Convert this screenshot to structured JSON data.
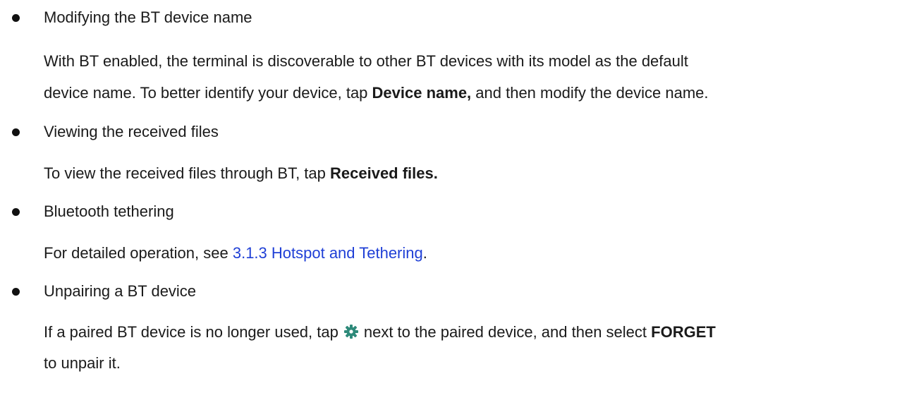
{
  "sections": [
    {
      "title": "Modifying the BT device name",
      "body_line1": "With BT enabled, the terminal is discoverable to other BT devices with its model as the default",
      "body_line2_pre": "device name. To better identify your device, tap ",
      "body_line2_bold": "Device name,",
      "body_line2_post": " and then modify the device name."
    },
    {
      "title": "Viewing the received files",
      "body_pre": "To view the received files through BT, tap ",
      "body_bold": "Received files."
    },
    {
      "title": "Bluetooth tethering",
      "body_pre": "For detailed operation, see ",
      "body_link": "3.1.3 Hotspot and Tethering",
      "body_post": "."
    },
    {
      "title": "Unpairing a BT device",
      "body_line1_pre": "If a paired BT device is no longer used, tap",
      "body_line1_icon": "gear-icon",
      "body_line1_post": "next to the paired device, and then select ",
      "body_line1_bold": "FORGET",
      "body_line2": "to unpair it."
    }
  ],
  "colors": {
    "text": "#1a1a1a",
    "link": "#1f3fd6",
    "gear_icon": "#2e8a7a"
  }
}
